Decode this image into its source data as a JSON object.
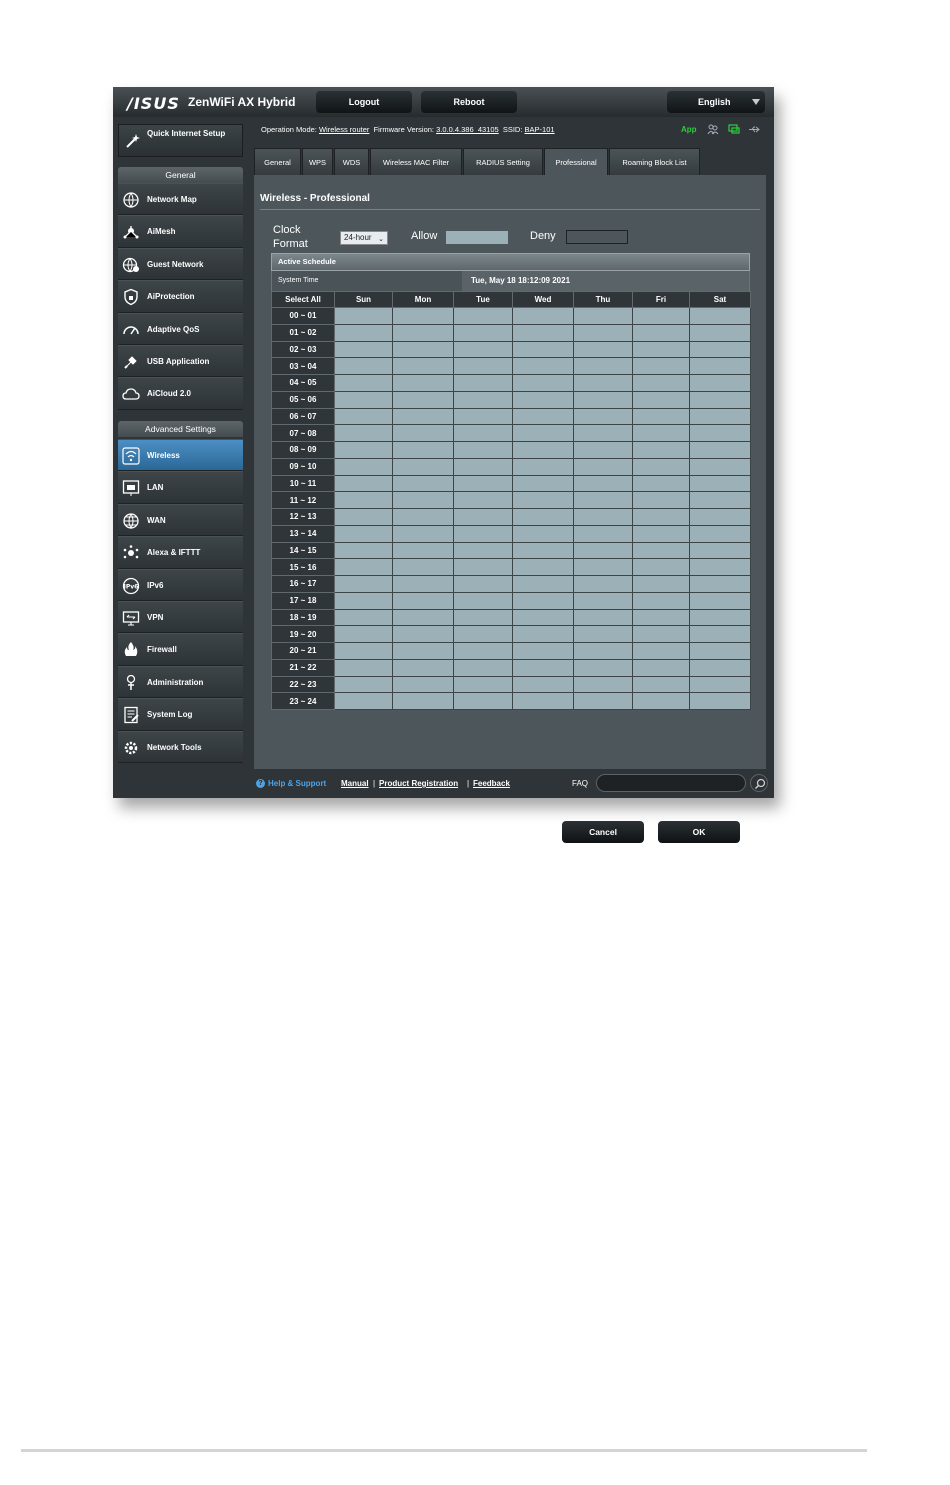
{
  "header": {
    "logo": "/ISUS",
    "product": "ZenWiFi AX Hybrid",
    "logout_label": "Logout",
    "reboot_label": "Reboot",
    "language": "English"
  },
  "sidebar": {
    "quick_setup": "Quick Internet Setup",
    "general_heading": "General",
    "general_items": [
      {
        "label": "Network Map",
        "icon": "network-map-icon"
      },
      {
        "label": "AiMesh",
        "icon": "aimesh-icon"
      },
      {
        "label": "Guest Network",
        "icon": "guest-network-icon"
      },
      {
        "label": "AiProtection",
        "icon": "shield-icon"
      },
      {
        "label": "Adaptive QoS",
        "icon": "gauge-icon"
      },
      {
        "label": "USB Application",
        "icon": "usb-icon"
      },
      {
        "label": "AiCloud 2.0",
        "icon": "cloud-icon"
      }
    ],
    "advanced_heading": "Advanced Settings",
    "advanced_items": [
      {
        "label": "Wireless",
        "icon": "wifi-icon",
        "active": true
      },
      {
        "label": "LAN",
        "icon": "lan-icon"
      },
      {
        "label": "WAN",
        "icon": "globe-icon"
      },
      {
        "label": "Alexa & IFTTT",
        "icon": "alexa-icon"
      },
      {
        "label": "IPv6",
        "icon": "ipv6-icon"
      },
      {
        "label": "VPN",
        "icon": "vpn-icon"
      },
      {
        "label": "Firewall",
        "icon": "firewall-icon"
      },
      {
        "label": "Administration",
        "icon": "admin-icon"
      },
      {
        "label": "System Log",
        "icon": "log-icon"
      },
      {
        "label": "Network Tools",
        "icon": "tools-icon"
      }
    ]
  },
  "status": {
    "op_mode_label": "Operation Mode:",
    "op_mode": "Wireless router",
    "firmware_label": "Firmware Version:",
    "firmware": "3.0.0.4.386_43105",
    "ssid_label": "SSID:",
    "ssid": "BAP-101",
    "app_label": "App"
  },
  "tabs": [
    "General",
    "WPS",
    "WDS",
    "Wireless MAC Filter",
    "RADIUS Setting",
    "Professional",
    "Roaming Block List"
  ],
  "active_tab": "Professional",
  "panel": {
    "title": "Wireless - Professional",
    "clock_format_label": "Clock Format",
    "clock_format_value": "24-hour",
    "allow_label": "Allow",
    "deny_label": "Deny",
    "allow_color": "#9cb0b8",
    "active_schedule_label": "Active Schedule",
    "system_time_label": "System Time",
    "system_time": "Tue, May 18 18:12:09 2021",
    "select_all": "Select All",
    "days": [
      "Sun",
      "Mon",
      "Tue",
      "Wed",
      "Thu",
      "Fri",
      "Sat"
    ],
    "hours": [
      "00 ~ 01",
      "01 ~ 02",
      "02 ~ 03",
      "03 ~ 04",
      "04 ~ 05",
      "05 ~ 06",
      "06 ~ 07",
      "07 ~ 08",
      "08 ~ 09",
      "09 ~ 10",
      "10 ~ 11",
      "11 ~ 12",
      "12 ~ 13",
      "13 ~ 14",
      "14 ~ 15",
      "15 ~ 16",
      "16 ~ 17",
      "17 ~ 18",
      "18 ~ 19",
      "19 ~ 20",
      "20 ~ 21",
      "21 ~ 22",
      "22 ~ 23",
      "23 ~ 24"
    ],
    "cancel_label": "Cancel",
    "ok_label": "OK"
  },
  "footer": {
    "help": "Help & Support",
    "manual": "Manual",
    "registration": "Product Registration",
    "feedback": "Feedback",
    "faq": "FAQ"
  }
}
